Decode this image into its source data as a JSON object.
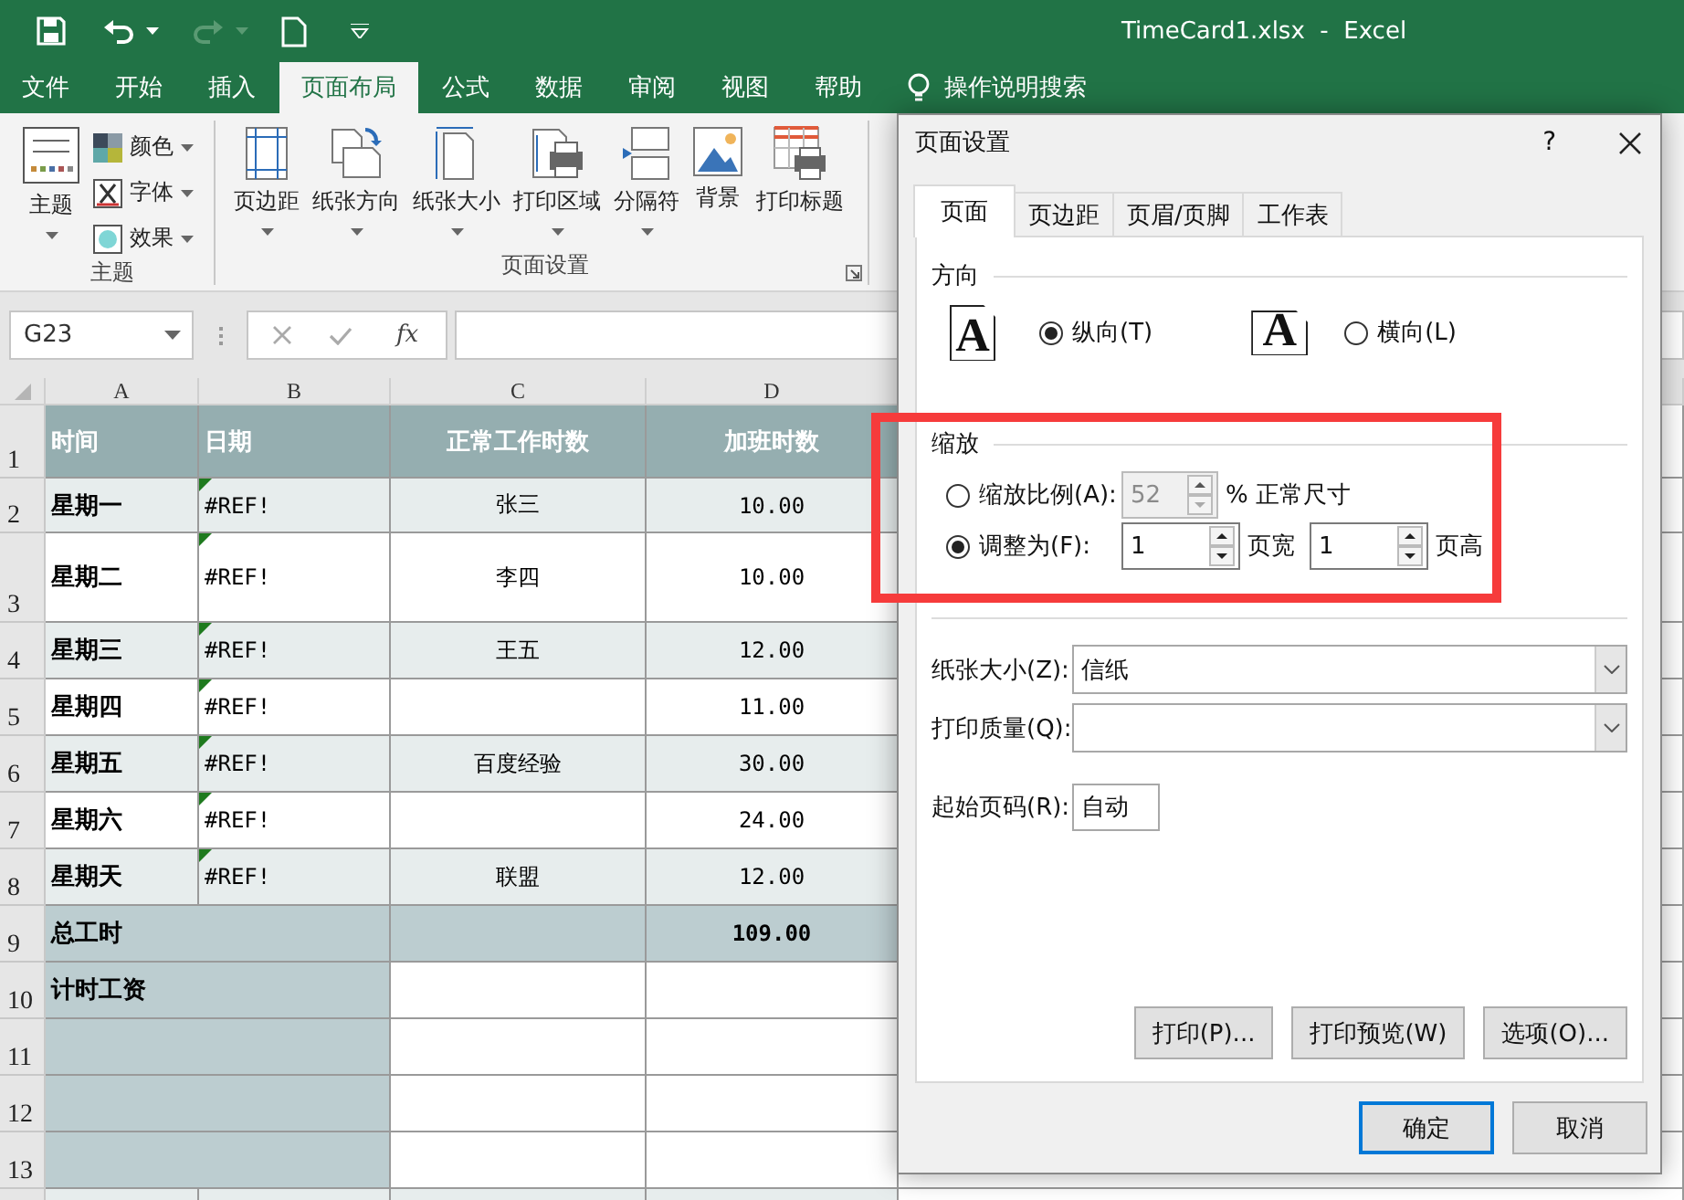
{
  "title_bar": {
    "title": "TimeCard1.xlsx  -  Excel"
  },
  "ribbon_tabs": [
    {
      "label": "文件",
      "selected": false
    },
    {
      "label": "开始",
      "selected": false
    },
    {
      "label": "插入",
      "selected": false
    },
    {
      "label": "页面布局",
      "selected": true
    },
    {
      "label": "公式",
      "selected": false
    },
    {
      "label": "数据",
      "selected": false
    },
    {
      "label": "审阅",
      "selected": false
    },
    {
      "label": "视图",
      "selected": false
    },
    {
      "label": "帮助",
      "selected": false
    }
  ],
  "tell_me": "操作说明搜索",
  "ribbon_groups": [
    {
      "label": "主题",
      "launcher": false,
      "buttons": [
        {
          "kind": "large",
          "label": "主题",
          "menu": true
        },
        {
          "kind": "small",
          "label": "颜色",
          "menu": true
        },
        {
          "kind": "small",
          "label": "字体",
          "menu": true
        },
        {
          "kind": "small",
          "label": "效果",
          "menu": true
        }
      ]
    },
    {
      "label": "页面设置",
      "launcher": true,
      "buttons": [
        {
          "kind": "large",
          "label": "页边距",
          "menu": true
        },
        {
          "kind": "large",
          "label": "纸张方向",
          "menu": true
        },
        {
          "kind": "large",
          "label": "纸张大小",
          "menu": true
        },
        {
          "kind": "large",
          "label": "打印区域",
          "menu": true
        },
        {
          "kind": "large",
          "label": "分隔符",
          "menu": true
        },
        {
          "kind": "large",
          "label": "背景",
          "menu": false
        },
        {
          "kind": "large",
          "label": "打印标题",
          "menu": false
        }
      ]
    }
  ],
  "formula_bar": {
    "name_box": "G23",
    "function_button": "fx"
  },
  "sheet": {
    "columns": [
      "A",
      "B",
      "C",
      "D"
    ],
    "rows": [
      {
        "number": "1",
        "kind": "header",
        "cells": [
          {
            "text": "时间"
          },
          {
            "text": "日期"
          },
          {
            "text": "正常工作时数"
          },
          {
            "text": "加班时数"
          }
        ]
      },
      {
        "number": "2",
        "kind": "band",
        "cells": [
          {
            "text": "星期一"
          },
          {
            "text": "#REF!",
            "flag": true
          },
          {
            "text": "张三"
          },
          {
            "text": "10.00"
          }
        ]
      },
      {
        "number": "3",
        "kind": "plain",
        "cells": [
          {
            "text": "星期二"
          },
          {
            "text": "#REF!",
            "flag": true
          },
          {
            "text": "李四"
          },
          {
            "text": "10.00"
          }
        ]
      },
      {
        "number": "4",
        "kind": "band",
        "cells": [
          {
            "text": "星期三"
          },
          {
            "text": "#REF!",
            "flag": true
          },
          {
            "text": "王五"
          },
          {
            "text": "12.00"
          }
        ]
      },
      {
        "number": "5",
        "kind": "plain",
        "cells": [
          {
            "text": "星期四"
          },
          {
            "text": "#REF!",
            "flag": true
          },
          {},
          {
            "text": "11.00"
          }
        ]
      },
      {
        "number": "6",
        "kind": "band",
        "cells": [
          {
            "text": "星期五"
          },
          {
            "text": "#REF!",
            "flag": true
          },
          {
            "text": "百度经验"
          },
          {
            "text": "30.00"
          }
        ]
      },
      {
        "number": "7",
        "kind": "plain",
        "cells": [
          {
            "text": "星期六"
          },
          {
            "text": "#REF!",
            "flag": true
          },
          {},
          {
            "text": "24.00"
          }
        ]
      },
      {
        "number": "8",
        "kind": "band",
        "cells": [
          {
            "text": "星期天"
          },
          {
            "text": "#REF!",
            "flag": true
          },
          {
            "text": "联盟"
          },
          {
            "text": "12.00"
          }
        ]
      },
      {
        "number": "9",
        "kind": "total",
        "cells": [
          {
            "text": "总工时"
          },
          {},
          {},
          {
            "text": "109.00"
          }
        ]
      },
      {
        "number": "10",
        "kind": "label",
        "cells": [
          {
            "text": "计时工资"
          },
          {},
          {},
          {}
        ]
      },
      {
        "number": "11",
        "kind": "label",
        "cells": [
          {},
          {},
          {},
          {}
        ]
      },
      {
        "number": "12",
        "kind": "label",
        "cells": [
          {},
          {},
          {},
          {}
        ]
      },
      {
        "number": "13",
        "kind": "label",
        "cells": [
          {},
          {},
          {},
          {}
        ]
      }
    ]
  },
  "dialog": {
    "title": "页面设置",
    "help": "?",
    "tabs": [
      {
        "label": "页面",
        "selected": true
      },
      {
        "label": "页边距",
        "selected": false
      },
      {
        "label": "页眉/页脚",
        "selected": false
      },
      {
        "label": "工作表",
        "selected": false
      }
    ],
    "orientation": {
      "heading": "方向",
      "options": [
        {
          "kind": "portrait",
          "icon_letter": "A",
          "label": "纵向(T)",
          "selected": true
        },
        {
          "kind": "landscape",
          "icon_letter": "A",
          "label": "横向(L)",
          "selected": false
        }
      ]
    },
    "scaling": {
      "heading": "缩放",
      "options": [
        {
          "kind": "percent",
          "label": "缩放比例(A):",
          "selected": false,
          "value": "52",
          "disabled": true,
          "suffix": "% 正常尺寸"
        },
        {
          "kind": "fit",
          "label": "调整为(F):",
          "selected": true,
          "wide": "1",
          "wide_label": "页宽",
          "tall": "1",
          "tall_label": "页高"
        }
      ]
    },
    "fields": [
      {
        "kind": "dropdown",
        "label": "纸张大小(Z):",
        "value": "信纸"
      },
      {
        "kind": "dropdown",
        "label": "打印质量(Q):"
      },
      {
        "kind": "text",
        "label": "起始页码(R):",
        "value": "自动"
      }
    ],
    "action_buttons": [
      {
        "label": "打印(P)...",
        "default": false
      },
      {
        "label": "打印预览(W)",
        "default": false
      },
      {
        "label": "选项(O)...",
        "default": false
      }
    ],
    "footer_buttons": [
      {
        "label": "确定",
        "default": true
      },
      {
        "label": "取消",
        "default": false
      }
    ]
  },
  "annotation": {
    "kind": "highlight"
  }
}
